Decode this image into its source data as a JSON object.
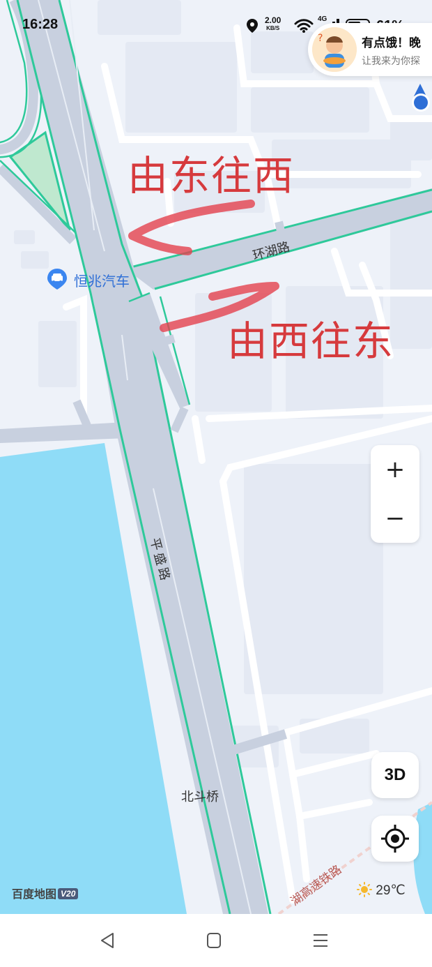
{
  "status_bar": {
    "time": "16:28",
    "net_speed_value": "2.00",
    "net_speed_unit": "KB/S",
    "network_type": "4G",
    "battery_percent": "61%",
    "icons": [
      "location-icon",
      "wifi-icon",
      "signal-icon",
      "battery-icon"
    ]
  },
  "promo": {
    "title": "有点饿！晚",
    "subtitle": "让我来为你探"
  },
  "annotations": {
    "east_to_west": "由东往西",
    "west_to_east": "由西往东"
  },
  "map_labels": {
    "road_huanhu": "环湖路",
    "road_pingsheng": "平盛路",
    "bridge_beidou": "北斗桥",
    "railway": "湖高速铁路",
    "poi_name": "恒兆汽车"
  },
  "controls": {
    "zoom_in": "+",
    "zoom_out": "−",
    "three_d": "3D"
  },
  "branding": {
    "logo_text": "百度地图",
    "logo_badge": "V20"
  },
  "weather": {
    "temperature": "29℃",
    "icon": "sun-icon"
  },
  "colors": {
    "water": "#8fdcf7",
    "road": "#c8d0df",
    "road_edge": "#2ec99a",
    "annotation": "#d63a3d",
    "background": "#eef2f9",
    "poi": "#2f6fd6"
  }
}
